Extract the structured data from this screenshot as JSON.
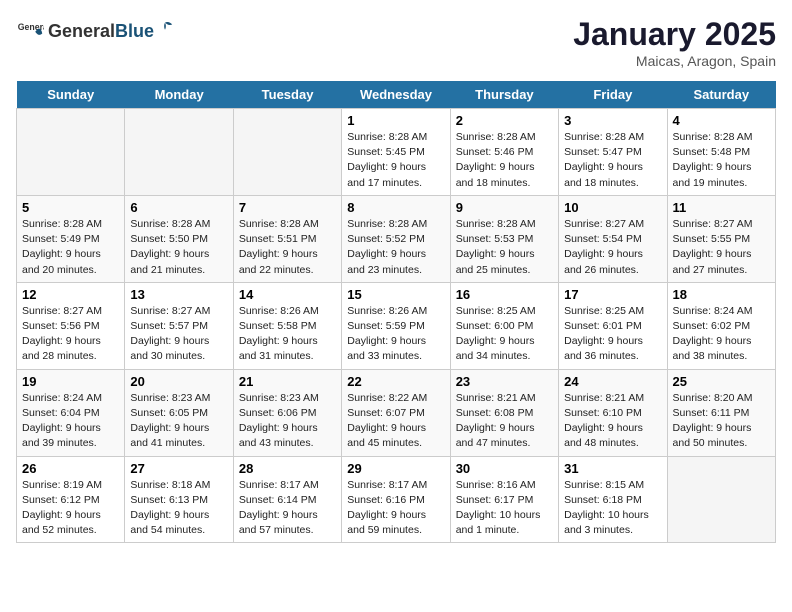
{
  "header": {
    "logo_general": "General",
    "logo_blue": "Blue",
    "title": "January 2025",
    "subtitle": "Maicas, Aragon, Spain"
  },
  "days_of_week": [
    "Sunday",
    "Monday",
    "Tuesday",
    "Wednesday",
    "Thursday",
    "Friday",
    "Saturday"
  ],
  "weeks": [
    [
      {
        "day": "",
        "info": ""
      },
      {
        "day": "",
        "info": ""
      },
      {
        "day": "",
        "info": ""
      },
      {
        "day": "1",
        "info": "Sunrise: 8:28 AM\nSunset: 5:45 PM\nDaylight: 9 hours and 17 minutes."
      },
      {
        "day": "2",
        "info": "Sunrise: 8:28 AM\nSunset: 5:46 PM\nDaylight: 9 hours and 18 minutes."
      },
      {
        "day": "3",
        "info": "Sunrise: 8:28 AM\nSunset: 5:47 PM\nDaylight: 9 hours and 18 minutes."
      },
      {
        "day": "4",
        "info": "Sunrise: 8:28 AM\nSunset: 5:48 PM\nDaylight: 9 hours and 19 minutes."
      }
    ],
    [
      {
        "day": "5",
        "info": "Sunrise: 8:28 AM\nSunset: 5:49 PM\nDaylight: 9 hours and 20 minutes."
      },
      {
        "day": "6",
        "info": "Sunrise: 8:28 AM\nSunset: 5:50 PM\nDaylight: 9 hours and 21 minutes."
      },
      {
        "day": "7",
        "info": "Sunrise: 8:28 AM\nSunset: 5:51 PM\nDaylight: 9 hours and 22 minutes."
      },
      {
        "day": "8",
        "info": "Sunrise: 8:28 AM\nSunset: 5:52 PM\nDaylight: 9 hours and 23 minutes."
      },
      {
        "day": "9",
        "info": "Sunrise: 8:28 AM\nSunset: 5:53 PM\nDaylight: 9 hours and 25 minutes."
      },
      {
        "day": "10",
        "info": "Sunrise: 8:27 AM\nSunset: 5:54 PM\nDaylight: 9 hours and 26 minutes."
      },
      {
        "day": "11",
        "info": "Sunrise: 8:27 AM\nSunset: 5:55 PM\nDaylight: 9 hours and 27 minutes."
      }
    ],
    [
      {
        "day": "12",
        "info": "Sunrise: 8:27 AM\nSunset: 5:56 PM\nDaylight: 9 hours and 28 minutes."
      },
      {
        "day": "13",
        "info": "Sunrise: 8:27 AM\nSunset: 5:57 PM\nDaylight: 9 hours and 30 minutes."
      },
      {
        "day": "14",
        "info": "Sunrise: 8:26 AM\nSunset: 5:58 PM\nDaylight: 9 hours and 31 minutes."
      },
      {
        "day": "15",
        "info": "Sunrise: 8:26 AM\nSunset: 5:59 PM\nDaylight: 9 hours and 33 minutes."
      },
      {
        "day": "16",
        "info": "Sunrise: 8:25 AM\nSunset: 6:00 PM\nDaylight: 9 hours and 34 minutes."
      },
      {
        "day": "17",
        "info": "Sunrise: 8:25 AM\nSunset: 6:01 PM\nDaylight: 9 hours and 36 minutes."
      },
      {
        "day": "18",
        "info": "Sunrise: 8:24 AM\nSunset: 6:02 PM\nDaylight: 9 hours and 38 minutes."
      }
    ],
    [
      {
        "day": "19",
        "info": "Sunrise: 8:24 AM\nSunset: 6:04 PM\nDaylight: 9 hours and 39 minutes."
      },
      {
        "day": "20",
        "info": "Sunrise: 8:23 AM\nSunset: 6:05 PM\nDaylight: 9 hours and 41 minutes."
      },
      {
        "day": "21",
        "info": "Sunrise: 8:23 AM\nSunset: 6:06 PM\nDaylight: 9 hours and 43 minutes."
      },
      {
        "day": "22",
        "info": "Sunrise: 8:22 AM\nSunset: 6:07 PM\nDaylight: 9 hours and 45 minutes."
      },
      {
        "day": "23",
        "info": "Sunrise: 8:21 AM\nSunset: 6:08 PM\nDaylight: 9 hours and 47 minutes."
      },
      {
        "day": "24",
        "info": "Sunrise: 8:21 AM\nSunset: 6:10 PM\nDaylight: 9 hours and 48 minutes."
      },
      {
        "day": "25",
        "info": "Sunrise: 8:20 AM\nSunset: 6:11 PM\nDaylight: 9 hours and 50 minutes."
      }
    ],
    [
      {
        "day": "26",
        "info": "Sunrise: 8:19 AM\nSunset: 6:12 PM\nDaylight: 9 hours and 52 minutes."
      },
      {
        "day": "27",
        "info": "Sunrise: 8:18 AM\nSunset: 6:13 PM\nDaylight: 9 hours and 54 minutes."
      },
      {
        "day": "28",
        "info": "Sunrise: 8:17 AM\nSunset: 6:14 PM\nDaylight: 9 hours and 57 minutes."
      },
      {
        "day": "29",
        "info": "Sunrise: 8:17 AM\nSunset: 6:16 PM\nDaylight: 9 hours and 59 minutes."
      },
      {
        "day": "30",
        "info": "Sunrise: 8:16 AM\nSunset: 6:17 PM\nDaylight: 10 hours and 1 minute."
      },
      {
        "day": "31",
        "info": "Sunrise: 8:15 AM\nSunset: 6:18 PM\nDaylight: 10 hours and 3 minutes."
      },
      {
        "day": "",
        "info": ""
      }
    ]
  ]
}
